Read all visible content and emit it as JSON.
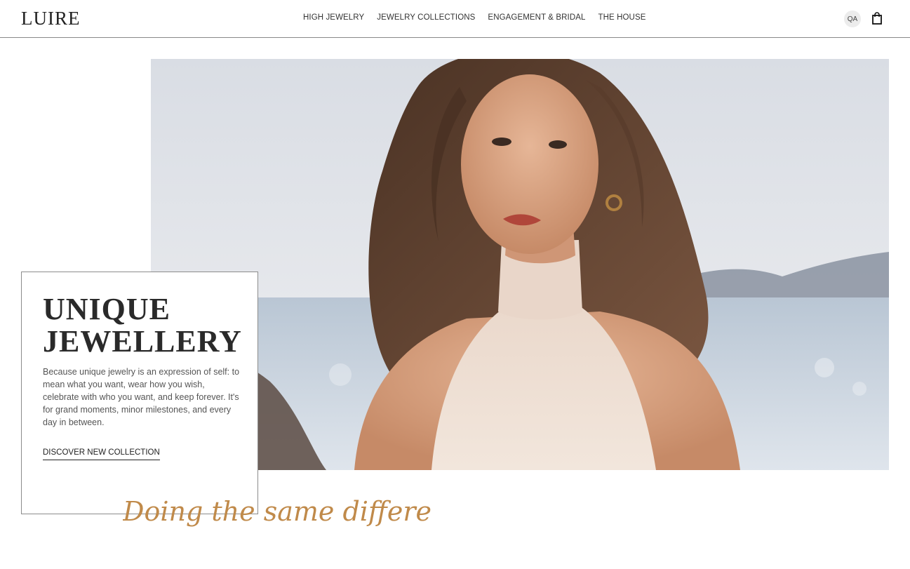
{
  "header": {
    "logo": "LUIRE",
    "nav": [
      {
        "label": "HIGH JEWELRY"
      },
      {
        "label": "JEWELRY COLLECTIONS"
      },
      {
        "label": "ENGAGEMENT & BRIDAL"
      },
      {
        "label": "THE HOUSE"
      }
    ],
    "avatar_initials": "QA",
    "bag_icon": "shopping-bag-icon"
  },
  "hero": {
    "image": "model-portrait-seaside"
  },
  "card": {
    "title_line1": "UNIQUE",
    "title_line2": "JEWELLERY",
    "body": "Because unique jewelry is an expression of self: to mean what you want, wear how you wish, celebrate with who you want, and keep forever. It's for grand moments, minor milestones, and every day in between.",
    "cta": "DISCOVER NEW COLLECTION"
  },
  "tagline": {
    "text": "Doing the same differently",
    "color": "#c08a4a"
  }
}
